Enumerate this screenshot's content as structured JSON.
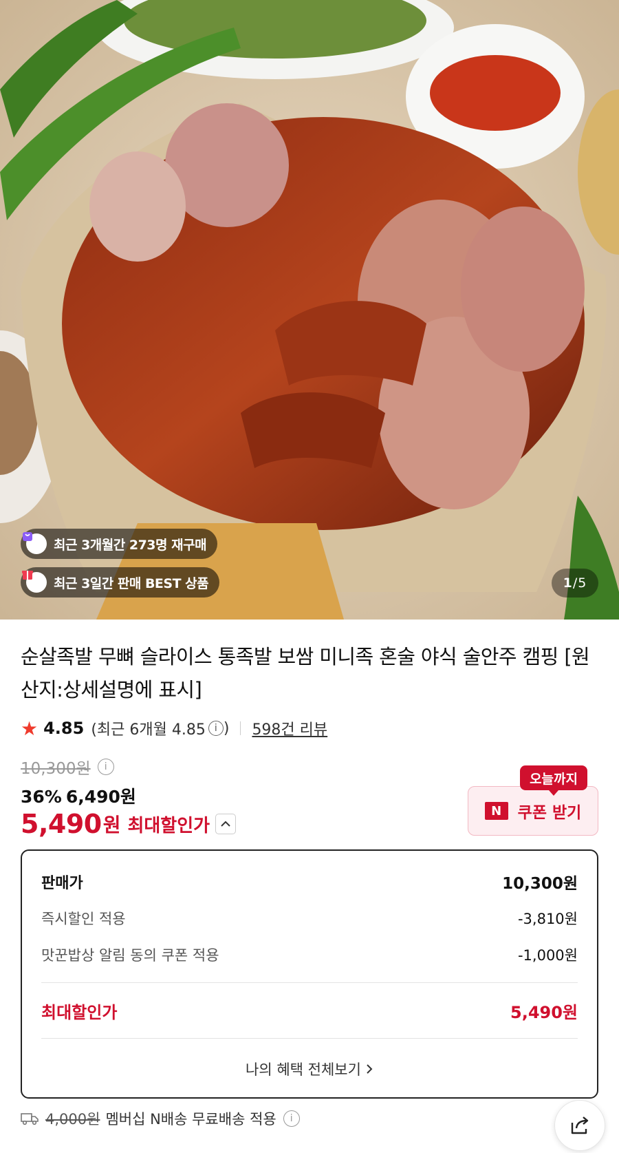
{
  "hero": {
    "badge_repurchase": "최근 3개월간 273명 재구매",
    "badge_best": "최근 3일간 판매 BEST 상품",
    "pager_current": "1",
    "pager_total": "5",
    "pager_sep": " / "
  },
  "product": {
    "title": "순살족발 무뼈 슬라이스 통족발 보쌈 미니족 혼술 야식 술안주 캠핑 [원산지:상세설명에 표시]"
  },
  "rating": {
    "score": "4.85",
    "recent_prefix": "(최근 6개월 4.85",
    "recent_suffix": ")",
    "info_icon": "i",
    "reviews": "598건 리뷰"
  },
  "price": {
    "original": "10,300원",
    "discount_pct": "36%",
    "discount_price": "6,490원",
    "max_price": "5,490",
    "max_unit": "원",
    "max_label": "최대할인가"
  },
  "coupon": {
    "tag": "오늘까지",
    "n_label": "N",
    "button": "쿠폰 받기"
  },
  "breakdown": {
    "rows": [
      {
        "label": "판매가",
        "value": "10,300원"
      },
      {
        "label": "즉시할인 적용",
        "value": "-3,810원"
      },
      {
        "label": "맛꾼밥상 알림 동의 쿠폰 적용",
        "value": "-1,000원"
      }
    ],
    "max_label": "최대할인가",
    "max_value": "5,490원",
    "all_benefits": "나의 혜택 전체보기"
  },
  "shipping": {
    "original_fee": "4,000원",
    "text": "멤버십 N배송 무료배송 적용"
  },
  "colors": {
    "accent": "#d0102e",
    "star": "#ef3b2d",
    "coupon_bg": "#fdeef1"
  }
}
